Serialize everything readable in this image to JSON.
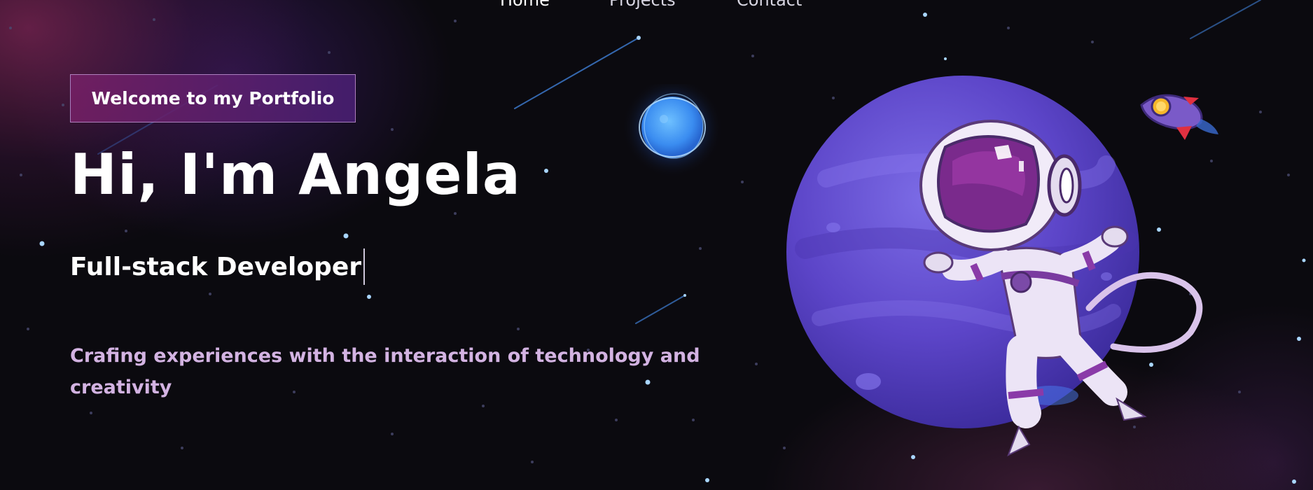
{
  "nav": {
    "links": [
      {
        "label": "Home"
      },
      {
        "label": "Projects"
      },
      {
        "label": "Contact"
      }
    ]
  },
  "hero": {
    "badge": "Welcome to my Portfolio",
    "title": "Hi, I'm Angela",
    "role": "Full-stack Developer",
    "tagline": "Crafing experiences with the interaction of technology and creativity"
  },
  "icons": {
    "astronaut": "astronaut-icon",
    "planet": "planet-icon",
    "moon": "moon-icon",
    "rocket": "rocket-icon"
  },
  "colors": {
    "background": "#0b0a0f",
    "badge_gradient_start": "#762066",
    "badge_gradient_end": "#4a2076",
    "tagline": "#d3b3e2",
    "planet": "#6a4fd0",
    "moon": "#4aa0ff"
  }
}
